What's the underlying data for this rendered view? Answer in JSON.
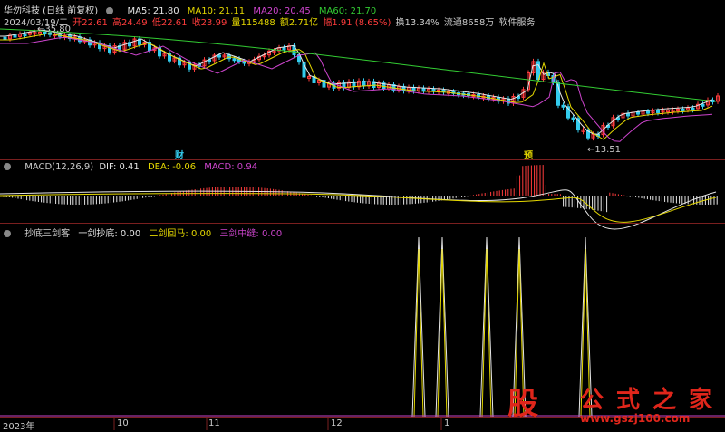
{
  "header": {
    "title": "华勿科技 (日线 前复权)",
    "ma5": "MA5: 21.80",
    "ma10": "MA10: 21.11",
    "ma20": "MA20: 20.45",
    "ma60": "MA60: 21.70"
  },
  "info": {
    "date": "2024/03/19/二",
    "open": "开22.61",
    "high": "高24.49",
    "low": "低22.61",
    "close": "收23.99",
    "volume": "量115488",
    "amount": "额2.71亿",
    "change": "幅1.91 (8.65%)",
    "turnover": "换13.34%",
    "float_cap": "流通8658万",
    "service": "软件服务"
  },
  "price_panel": {
    "high_label": "35.80",
    "low_label": "13.51",
    "marker_cai": "财",
    "marker_yu": "预"
  },
  "macd": {
    "title": "MACD(12,26,9)",
    "dif": "DIF: 0.41",
    "dea": "DEA: -0.06",
    "macd": "MACD: 0.94"
  },
  "indicator": {
    "title": "抄底三剑客",
    "one": "一剑抄底: 0.00",
    "two": "二剑回马: 0.00",
    "three": "三剑中缝: 0.00"
  },
  "axis": {
    "labels": [
      "2023年",
      "10",
      "11",
      "12",
      "1"
    ]
  },
  "watermark": {
    "big_char": "股",
    "brand": "公式之家",
    "url": "www.gszj100.com"
  },
  "colors": {
    "ma5": "#e6e6e6",
    "ma10": "#e5d800",
    "ma20": "#cc44cc",
    "ma60": "#33cc33",
    "up": "#ff3c3c",
    "down": "#33ccee",
    "separator": "#7a1f1f"
  }
}
